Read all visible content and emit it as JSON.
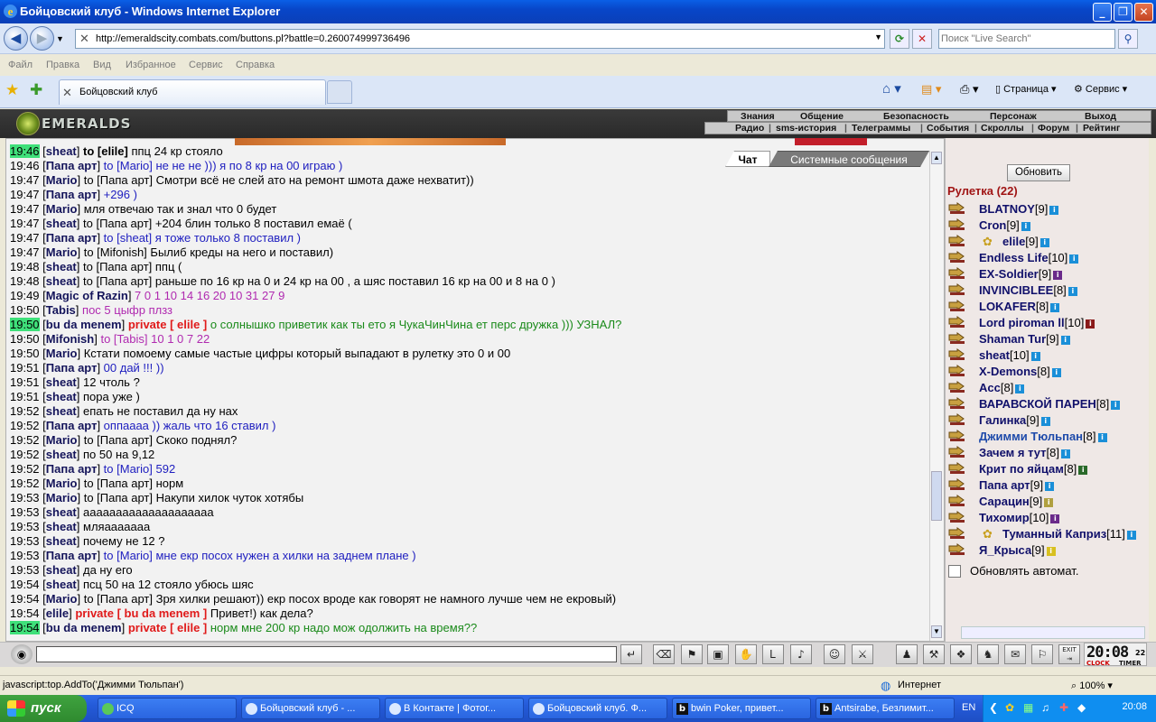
{
  "window": {
    "title": "Бойцовский клуб - Windows Internet Explorer"
  },
  "address": {
    "url": "http://emeraldscity.combats.com/buttons.pl?battle=0.260074999736496",
    "search_placeholder": "Поиск \"Live Search\""
  },
  "menubar": [
    "Файл",
    "Правка",
    "Вид",
    "Избранное",
    "Сервис",
    "Справка"
  ],
  "tab": {
    "label": "Бойцовский клуб"
  },
  "ietools": {
    "page": "Страница",
    "service": "Сервис"
  },
  "game": {
    "logo": "EMERALDS",
    "topmenu": [
      "Знания",
      "Общение",
      "Безопасность",
      "Персонаж",
      "Выход"
    ],
    "submenu": [
      "Радио",
      "sms-история",
      "Телеграммы",
      "События",
      "Скроллы",
      "Форум",
      "Рейтинг"
    ]
  },
  "chattabs": {
    "chat": "Чат",
    "system": "Системные сообщения"
  },
  "chat": [
    {
      "t": "19:46",
      "hl": true,
      "n": "sheat",
      "to": "to [elile]",
      "msg": "ппц 24 кр стояло",
      "mc": "",
      "tb": true
    },
    {
      "t": "19:46",
      "hl": false,
      "n": "Папа арт",
      "to": "to [Mario]",
      "msg": "не не не ))) я по 8 кр на 00 играю )",
      "mc": "blue"
    },
    {
      "t": "19:47",
      "hl": false,
      "n": "Mario",
      "to": "to [Папа арт]",
      "msg": "Смотри всё не слей ато на ремонт шмота даже нехватит))",
      "mc": ""
    },
    {
      "t": "19:47",
      "hl": false,
      "n": "Папа арт",
      "to": "",
      "msg": "+296 )",
      "mc": "blue"
    },
    {
      "t": "19:47",
      "hl": false,
      "n": "Mario",
      "to": "",
      "msg": "мля отвечаю так и знал что 0 будет",
      "mc": ""
    },
    {
      "t": "19:47",
      "hl": false,
      "n": "sheat",
      "to": "to [Папа арт]",
      "msg": "+204 блин только 8 поставил емаё (",
      "mc": ""
    },
    {
      "t": "19:47",
      "hl": false,
      "n": "Папа арт",
      "to": "to [sheat]",
      "msg": "я тоже только 8 поставил )",
      "mc": "blue"
    },
    {
      "t": "19:47",
      "hl": false,
      "n": "Mario",
      "to": "to [Mifonish]",
      "msg": "Былиб креды на него и поставил)",
      "mc": ""
    },
    {
      "t": "19:48",
      "hl": false,
      "n": "sheat",
      "to": "to [Папа арт]",
      "msg": "ппц (",
      "mc": ""
    },
    {
      "t": "19:48",
      "hl": false,
      "n": "sheat",
      "to": "to [Папа арт]",
      "msg": "раньше по 16 кр на 0 и 24 кр на 00 , а шяс поставил 16 кр на 00 и 8 на 0 )",
      "mc": ""
    },
    {
      "t": "19:49",
      "hl": false,
      "n": "Magic of Razin",
      "to": "",
      "msg": "7 0 1 10 14 16 20 10 31 27 9",
      "mc": "pink"
    },
    {
      "t": "19:50",
      "hl": false,
      "n": "Tabis",
      "to": "",
      "msg": "пос 5 цыфр плзз",
      "mc": "pink"
    },
    {
      "t": "19:50",
      "hl": true,
      "n": "bu da menem",
      "priv": "private [ elile ]",
      "msg": "о солнышко приветик как ты ето я ЧукаЧинЧина ет перс дружка ))) УЗНАЛ?",
      "mc": "green"
    },
    {
      "t": "19:50",
      "hl": false,
      "n": "Mifonish",
      "to": "to [Tabis]",
      "msg": "10 1 0 7 22",
      "mc": "pink"
    },
    {
      "t": "19:50",
      "hl": false,
      "n": "Mario",
      "to": "",
      "msg": "Кстати помоему самые частые цифры который выпадают в рулетку это 0 и 00",
      "mc": ""
    },
    {
      "t": "19:51",
      "hl": false,
      "n": "Папа арт",
      "to": "",
      "msg": "00 дай !!! ))",
      "mc": "blue"
    },
    {
      "t": "19:51",
      "hl": false,
      "n": "sheat",
      "to": "",
      "msg": "12 чтоль ?",
      "mc": ""
    },
    {
      "t": "19:51",
      "hl": false,
      "n": "sheat",
      "to": "",
      "msg": "пора уже )",
      "mc": ""
    },
    {
      "t": "19:52",
      "hl": false,
      "n": "sheat",
      "to": "",
      "msg": "епать не поставил да ну нах",
      "mc": ""
    },
    {
      "t": "19:52",
      "hl": false,
      "n": "Папа арт",
      "to": "",
      "msg": "оппаааа )) жаль что 16 ставил )",
      "mc": "blue"
    },
    {
      "t": "19:52",
      "hl": false,
      "n": "Mario",
      "to": "to [Папа арт]",
      "msg": "Скоко поднял?",
      "mc": ""
    },
    {
      "t": "19:52",
      "hl": false,
      "n": "sheat",
      "to": "",
      "msg": "по 50 на 9,12",
      "mc": ""
    },
    {
      "t": "19:52",
      "hl": false,
      "n": "Папа арт",
      "to": "to [Mario]",
      "msg": "592",
      "mc": "blue"
    },
    {
      "t": "19:52",
      "hl": false,
      "n": "Mario",
      "to": "to [Папа арт]",
      "msg": "норм",
      "mc": ""
    },
    {
      "t": "19:53",
      "hl": false,
      "n": "Mario",
      "to": "to [Папа арт]",
      "msg": "Накупи хилок чуток хотябы",
      "mc": ""
    },
    {
      "t": "19:53",
      "hl": false,
      "n": "sheat",
      "to": "",
      "msg": "аааааааааааааааааааа",
      "mc": ""
    },
    {
      "t": "19:53",
      "hl": false,
      "n": "sheat",
      "to": "",
      "msg": "мляааааааа",
      "mc": ""
    },
    {
      "t": "19:53",
      "hl": false,
      "n": "sheat",
      "to": "",
      "msg": "почему не 12 ?",
      "mc": ""
    },
    {
      "t": "19:53",
      "hl": false,
      "n": "Папа арт",
      "to": "to [Mario]",
      "msg": "мне екр посох нужен а хилки на заднем плане )",
      "mc": "blue"
    },
    {
      "t": "19:53",
      "hl": false,
      "n": "sheat",
      "to": "",
      "msg": "да ну его",
      "mc": ""
    },
    {
      "t": "19:54",
      "hl": false,
      "n": "sheat",
      "to": "",
      "msg": "псц 50 на 12 стояло убюсь шяс",
      "mc": ""
    },
    {
      "t": "19:54",
      "hl": false,
      "n": "Mario",
      "to": "to [Папа арт]",
      "msg": "Зря хилки решают)) екр посох вроде как говорят не намного лучше чем не екровый)",
      "mc": ""
    },
    {
      "t": "19:54",
      "hl": false,
      "n": "elile",
      "priv": "private [ bu da menem ]",
      "msg": "Привет!) как дела?",
      "mc": ""
    },
    {
      "t": "19:54",
      "hl": true,
      "n": "bu da menem",
      "priv": "private [ elile ]",
      "msg": "норм мне 200 кр надо мож одолжить на время??",
      "mc": "green"
    }
  ],
  "right": {
    "refresh": "Обновить",
    "room": "Рулетка (22)",
    "users": [
      {
        "n": "BLATNOY",
        "lv": "[9]",
        "c": "#1a8fd8"
      },
      {
        "n": "Cron",
        "lv": "[9]",
        "c": "#1a8fd8"
      },
      {
        "n": "elile",
        "lv": "[9]",
        "c": "#1a8fd8",
        "pre": true
      },
      {
        "n": "Endless Life",
        "lv": "[10]",
        "c": "#1a8fd8"
      },
      {
        "n": "EX-Soldier",
        "lv": "[9]",
        "c": "#6a2a8a"
      },
      {
        "n": "INVINCIBLEE",
        "lv": "[8]",
        "c": "#1a8fd8"
      },
      {
        "n": "LOKAFER",
        "lv": "[8]",
        "c": "#1a8fd8"
      },
      {
        "n": "Lord piroman ll",
        "lv": "[10]",
        "c": "#8a1a1a"
      },
      {
        "n": "Shaman Tur",
        "lv": "[9]",
        "c": "#1a8fd8"
      },
      {
        "n": "sheat",
        "lv": "[10]",
        "c": "#1a8fd8"
      },
      {
        "n": "X-Demons",
        "lv": "[8]",
        "c": "#1a8fd8"
      },
      {
        "n": "Acc",
        "lv": "[8]",
        "c": "#1a8fd8"
      },
      {
        "n": "ВАРАВСКОЙ ПАРЕН",
        "lv": "[8]",
        "c": "#1a8fd8"
      },
      {
        "n": "Галинка",
        "lv": "[9]",
        "c": "#1a8fd8"
      },
      {
        "n": "Джимми Тюльпан",
        "lv": "[8]",
        "c": "#1a8fd8",
        "lt": true
      },
      {
        "n": "Зачем я тут",
        "lv": "[8]",
        "c": "#1a8fd8"
      },
      {
        "n": "Крит по яйцам",
        "lv": "[8]",
        "c": "#2a6a2a"
      },
      {
        "n": "Папа арт",
        "lv": "[9]",
        "c": "#1a8fd8"
      },
      {
        "n": "Сарацин",
        "lv": "[9]",
        "c": "#b0a040"
      },
      {
        "n": "Тихомир",
        "lv": "[10]",
        "c": "#6a2a8a"
      },
      {
        "n": "Туманный Каприз",
        "lv": "[11]",
        "c": "#1a8fd8",
        "pre": true
      },
      {
        "n": "Я_Крыса",
        "lv": "[9]",
        "c": "#d8c020"
      }
    ],
    "autorefresh": "Обновлять автомат."
  },
  "clock": {
    "time": "20:08",
    "sec": "22",
    "l1": "CLOCK",
    "l2": "TIMER"
  },
  "status": {
    "text": "javascript:top.AddTo('Джимми Тюльпан')",
    "zone": "Интернет",
    "zoom": "100%"
  },
  "taskbar": {
    "start": "пуск",
    "tasks": [
      "ICQ",
      "Бойцовский клуб - ...",
      "В Контакте | Фотог...",
      "Бойцовский клуб. Ф...",
      "bwin Poker, привет...",
      "Antsirabe, Безлимит..."
    ],
    "lang": "EN",
    "time": "20:08"
  }
}
